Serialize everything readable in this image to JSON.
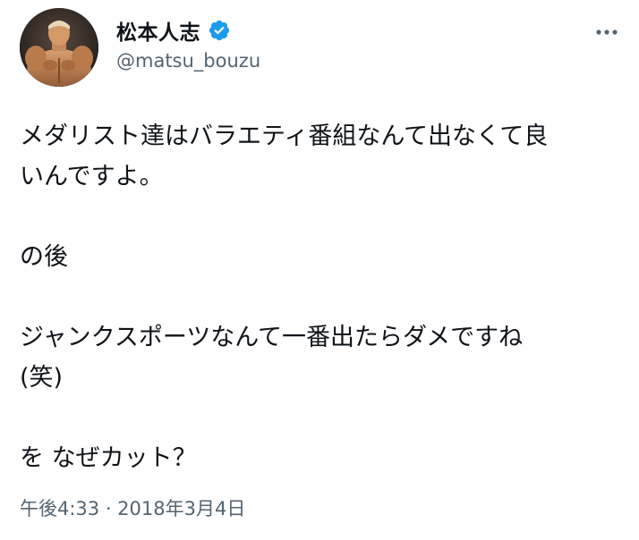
{
  "author": {
    "display_name": "松本人志",
    "handle": "@matsu_bouzu",
    "verified": true,
    "verified_color": "#1d9bf0"
  },
  "icons": {
    "verified": "verified-badge-icon",
    "more": "more-horizontal-icon"
  },
  "tweet": {
    "paragraphs": [
      "メダリスト達はバラエティ番組なんて出なくて良\nいんですよ。",
      "の後",
      "ジャンクスポーツなんて一番出たらダメですね\n(笑)",
      "を なぜカット？"
    ],
    "timestamp": "午後4:33 · 2018年3月4日"
  },
  "colors": {
    "text": "#0f1419",
    "secondary": "#536471",
    "accent": "#1d9bf0"
  }
}
